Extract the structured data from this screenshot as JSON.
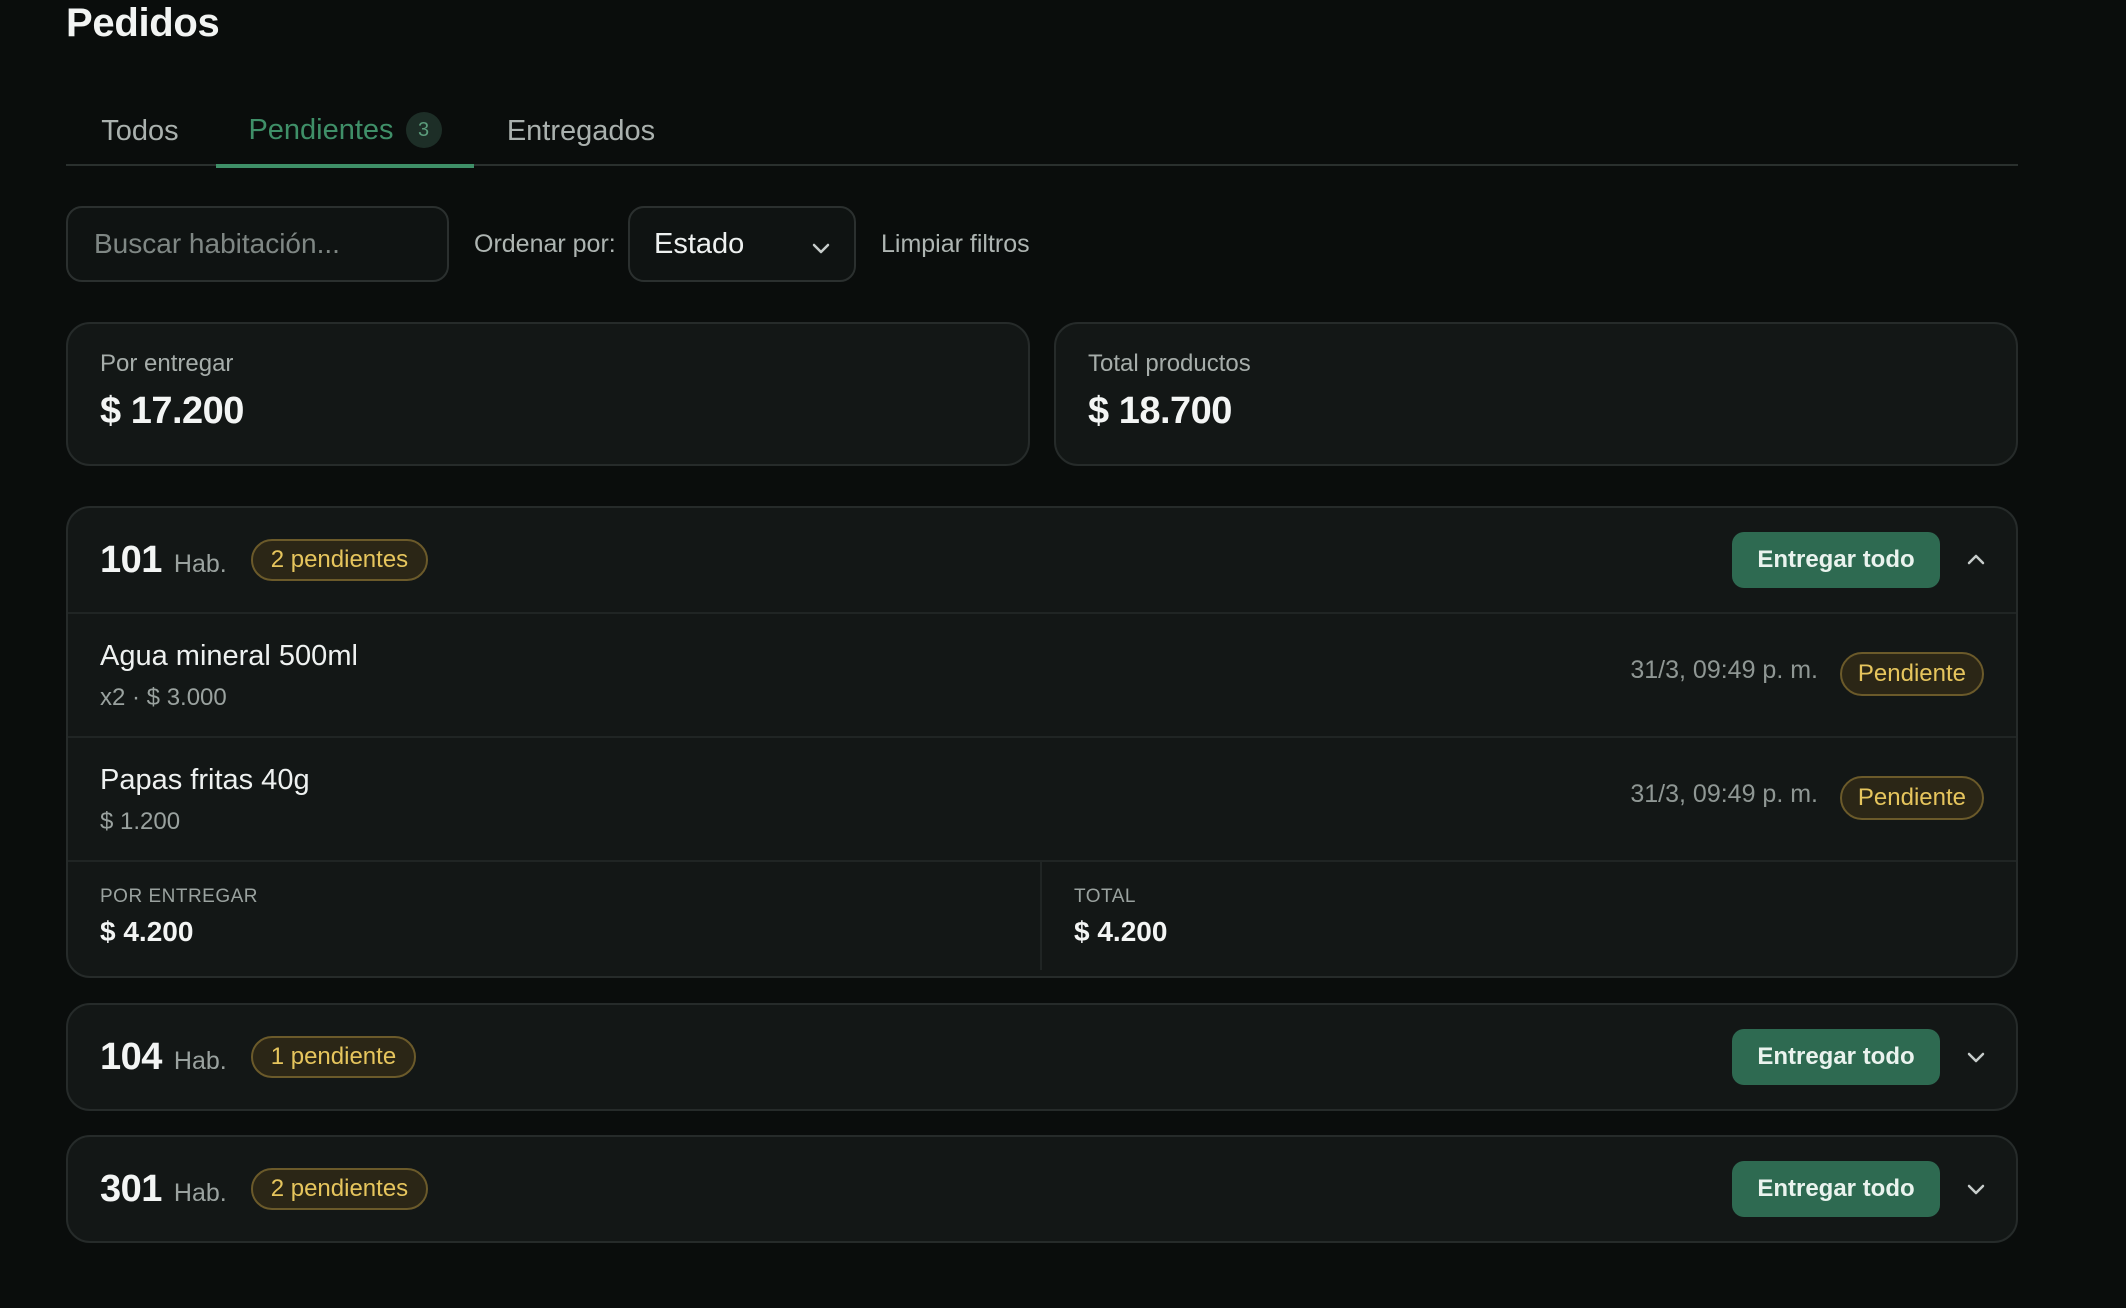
{
  "page_title": "Pedidos",
  "tabs": [
    {
      "label": "Todos"
    },
    {
      "label": "Pendientes",
      "count": "3"
    },
    {
      "label": "Entregados"
    }
  ],
  "filters": {
    "search_placeholder": "Buscar habitación...",
    "sort_label": "Ordenar por:",
    "sort_value": "Estado",
    "clear_label": "Limpiar filtros"
  },
  "summary": {
    "to_deliver_label": "Por entregar",
    "to_deliver_value": "$ 17.200",
    "total_label": "Total productos",
    "total_value": "$ 18.700"
  },
  "rooms": [
    {
      "number": "101",
      "hab": "Hab.",
      "pending": "2 pendientes",
      "action": "Entregar todo",
      "expanded": true,
      "items": [
        {
          "name": "Agua mineral 500ml",
          "meta": "x2 · $ 3.000",
          "time": "31/3, 09:49 p. m.",
          "status": "Pendiente"
        },
        {
          "name": "Papas fritas 40g",
          "meta": "$ 1.200",
          "time": "31/3, 09:49 p. m.",
          "status": "Pendiente"
        }
      ],
      "footer": {
        "to_deliver_label": "POR ENTREGAR",
        "to_deliver_value": "$ 4.200",
        "total_label": "TOTAL",
        "total_value": "$ 4.200"
      }
    },
    {
      "number": "104",
      "hab": "Hab.",
      "pending": "1 pendiente",
      "action": "Entregar todo",
      "expanded": false
    },
    {
      "number": "301",
      "hab": "Hab.",
      "pending": "2 pendientes",
      "action": "Entregar todo",
      "expanded": false
    }
  ],
  "colors": {
    "background": "#0a0d0c",
    "card": "#131716",
    "accent": "#3f8f68",
    "button": "#2e6a51",
    "pending": "#e6c55d"
  }
}
